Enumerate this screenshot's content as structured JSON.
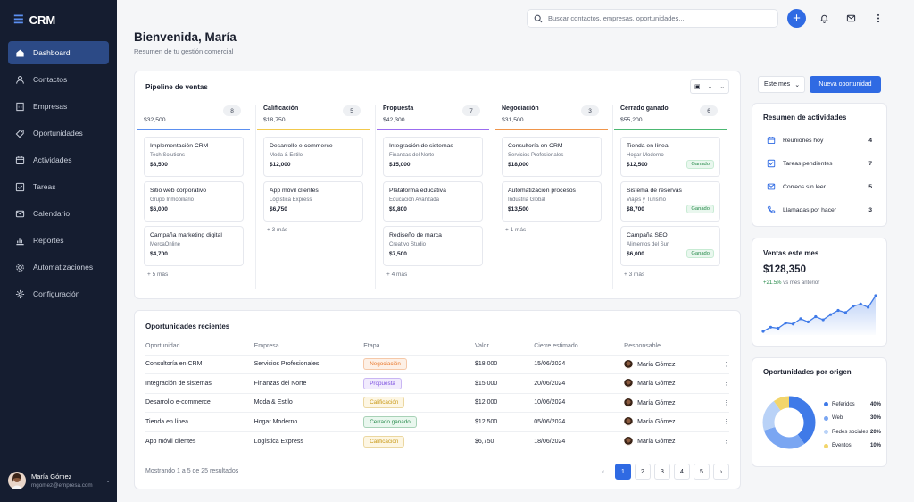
{
  "app": {
    "name": "CRM"
  },
  "sidebar": {
    "items": [
      {
        "label": "Dashboard",
        "icon": "home-icon",
        "active": true
      },
      {
        "label": "Contactos",
        "icon": "user-icon"
      },
      {
        "label": "Empresas",
        "icon": "building-icon"
      },
      {
        "label": "Oportunidades",
        "icon": "tag-icon"
      },
      {
        "label": "Actividades",
        "icon": "calendar-icon"
      },
      {
        "label": "Tareas",
        "icon": "checkbox-icon"
      },
      {
        "label": "Calendario",
        "icon": "mail-icon"
      },
      {
        "label": "Reportes",
        "icon": "chart-icon"
      },
      {
        "label": "Automatizaciones",
        "icon": "gear-icon"
      },
      {
        "label": "Configuración",
        "icon": "settings-icon"
      }
    ],
    "user": {
      "name": "María Gómez",
      "email": "mgomez@empresa.com"
    }
  },
  "header": {
    "search_placeholder": "Buscar contactos, empresas, oportunidades..."
  },
  "page": {
    "title": "Bienvenida, María",
    "subtitle": "Resumen de tu gestión comercial"
  },
  "pipeline": {
    "title": "Pipeline de ventas",
    "columns": [
      {
        "name": "",
        "amount": "$32,500",
        "count": "8",
        "color": "#5b8ff0",
        "more": "+ 5 más",
        "deals": [
          {
            "name": "Implementación CRM",
            "company": "Tech Solutions",
            "value": "$8,500"
          },
          {
            "name": "Sitio web corporativo",
            "company": "Grupo Inmobiliario",
            "value": "$6,000"
          },
          {
            "name": "Campaña marketing digital",
            "company": "MercaOnline",
            "value": "$4,700"
          }
        ]
      },
      {
        "name": "Calificación",
        "amount": "$18,750",
        "count": "5",
        "color": "#f2c94c",
        "more": "+ 3 más",
        "deals": [
          {
            "name": "Desarrollo e-commerce",
            "company": "Moda & Estilo",
            "value": "$12,000"
          },
          {
            "name": "App móvil clientes",
            "company": "Logística Express",
            "value": "$6,750"
          }
        ]
      },
      {
        "name": "Propuesta",
        "amount": "$42,300",
        "count": "7",
        "color": "#9b6cf0",
        "more": "+ 4 más",
        "deals": [
          {
            "name": "Integración de sistemas",
            "company": "Finanzas del Norte",
            "value": "$15,000"
          },
          {
            "name": "Plataforma educativa",
            "company": "Educación Avanzada",
            "value": "$9,800"
          },
          {
            "name": "Rediseño de marca",
            "company": "Creativo Studio",
            "value": "$7,500"
          }
        ]
      },
      {
        "name": "Negociación",
        "amount": "$31,500",
        "count": "3",
        "color": "#f0954a",
        "more": "+ 1 más",
        "deals": [
          {
            "name": "Consultoría en CRM",
            "company": "Servicios Profesionales",
            "value": "$18,000"
          },
          {
            "name": "Automatización procesos",
            "company": "Industria Global",
            "value": "$13,500"
          }
        ]
      },
      {
        "name": "Cerrado ganado",
        "amount": "$55,200",
        "count": "6",
        "color": "#4cb872",
        "more": "+ 3 más",
        "deals": [
          {
            "name": "Tienda en línea",
            "company": "Hogar Moderno",
            "value": "$12,500",
            "badge": "Ganado"
          },
          {
            "name": "Sistema de reservas",
            "company": "Viajes y Turismo",
            "value": "$8,700",
            "badge": "Ganado"
          },
          {
            "name": "Campaña SEO",
            "company": "Alimentos del Sur",
            "value": "$6,000",
            "badge": "Ganado"
          }
        ]
      }
    ]
  },
  "opportunities": {
    "title": "Oportunidades recientes",
    "headers": [
      "Oportunidad",
      "Empresa",
      "Etapa",
      "Valor",
      "Cierre estimado",
      "Responsable"
    ],
    "rows": [
      {
        "name": "Consultoría en CRM",
        "company": "Servicios Profesionales",
        "stage": "Negociación",
        "stage_color": "#e8782c",
        "stage_bg": "#fdf0e6",
        "value": "$18,000",
        "close": "15/06/2024",
        "owner": "María Gómez"
      },
      {
        "name": "Integración de sistemas",
        "company": "Finanzas del Norte",
        "stage": "Propuesta",
        "stage_color": "#7b4fe0",
        "stage_bg": "#f1ebfd",
        "value": "$15,000",
        "close": "20/06/2024",
        "owner": "María Gómez"
      },
      {
        "name": "Desarrollo e-commerce",
        "company": "Moda & Estilo",
        "stage": "Calificación",
        "stage_color": "#c99a1a",
        "stage_bg": "#fdf6e3",
        "value": "$12,000",
        "close": "10/06/2024",
        "owner": "María Gómez"
      },
      {
        "name": "Tienda en línea",
        "company": "Hogar Moderno",
        "stage": "Cerrado ganado",
        "stage_color": "#268a4a",
        "stage_bg": "#e9f7ee",
        "value": "$12,500",
        "close": "05/06/2024",
        "owner": "María Gómez"
      },
      {
        "name": "App móvil clientes",
        "company": "Logística Express",
        "stage": "Calificación",
        "stage_color": "#c99a1a",
        "stage_bg": "#fdf6e3",
        "value": "$6,750",
        "close": "18/06/2024",
        "owner": "María Gómez"
      }
    ],
    "footer": "Mostrando 1 a 5 de 25 resultados",
    "pages": [
      "1",
      "2",
      "3",
      "4",
      "5"
    ]
  },
  "controls": {
    "period": "Este mes",
    "new_opportunity": "Nueva oportunidad"
  },
  "activities": {
    "title": "Resumen de actividades",
    "items": [
      {
        "label": "Reuniones hoy",
        "count": "4",
        "icon": "calendar-icon"
      },
      {
        "label": "Tareas pendientes",
        "count": "7",
        "icon": "checkbox-icon"
      },
      {
        "label": "Correos sin leer",
        "count": "5",
        "icon": "mail-icon"
      },
      {
        "label": "Llamadas por hacer",
        "count": "3",
        "icon": "phone-icon"
      }
    ]
  },
  "sales": {
    "title": "Ventas este mes",
    "amount": "$128,350",
    "change": "+21.5%",
    "change_label": "vs mes anterior",
    "trend": [
      10,
      14,
      13,
      18,
      17,
      22,
      19,
      24,
      21,
      26,
      30,
      28,
      34,
      36,
      33,
      44
    ]
  },
  "origin": {
    "title": "Oportunidades por origen",
    "items": [
      {
        "label": "Referidos",
        "pct": "40%",
        "value": 40,
        "color": "#3f7ae8"
      },
      {
        "label": "Web",
        "pct": "30%",
        "value": 30,
        "color": "#7aa6f2"
      },
      {
        "label": "Redes sociales",
        "pct": "20%",
        "value": 20,
        "color": "#b9d2f7"
      },
      {
        "label": "Eventos",
        "pct": "10%",
        "value": 10,
        "color": "#f2d56b"
      }
    ]
  },
  "colors": {
    "accent": "#2f6ae3",
    "sidebar": "#151d30"
  }
}
